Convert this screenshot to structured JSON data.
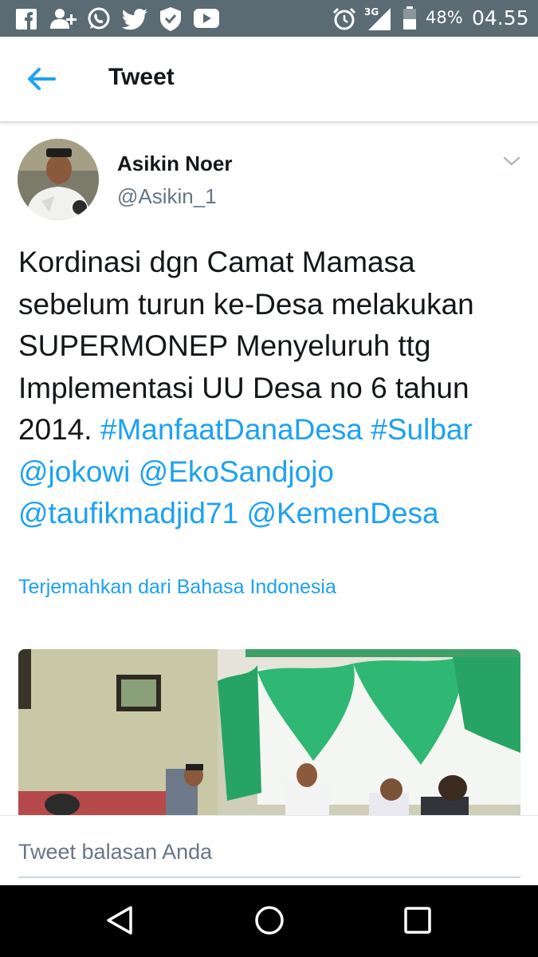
{
  "status_bar": {
    "icons": [
      "facebook-icon",
      "add-friend-icon",
      "whatsapp-icon",
      "twitter-icon",
      "shield-icon",
      "youtube-icon",
      "alarm-icon",
      "signal-3g-icon",
      "battery-icon"
    ],
    "network": "3G",
    "battery": "48%",
    "time": "04.55"
  },
  "header": {
    "back_icon": "arrow-left-icon",
    "title": "Tweet"
  },
  "tweet": {
    "author_name": "Asikin Noer",
    "author_handle": "@Asikin_1",
    "text_plain": "Kordinasi dgn Camat Mamasa sebelum turun ke-Desa melakukan SUPERMONEP Menyeluruh ttg Implementasi UU Desa no 6 tahun 2014.",
    "hashtags": [
      "#ManfaatDanaDesa",
      "#Sulbar"
    ],
    "mentions": [
      "@jokowi",
      "@EkoSandjojo",
      "@taufikmadjid71",
      "@KemenDesa"
    ],
    "translate_label": "Terjemahkan dari Bahasa Indonesia"
  },
  "reply": {
    "placeholder": "Tweet balasan Anda"
  },
  "colors": {
    "link": "#1da1f2",
    "status_bar": "#5b6b73",
    "text": "#14171a",
    "muted": "#657786"
  }
}
